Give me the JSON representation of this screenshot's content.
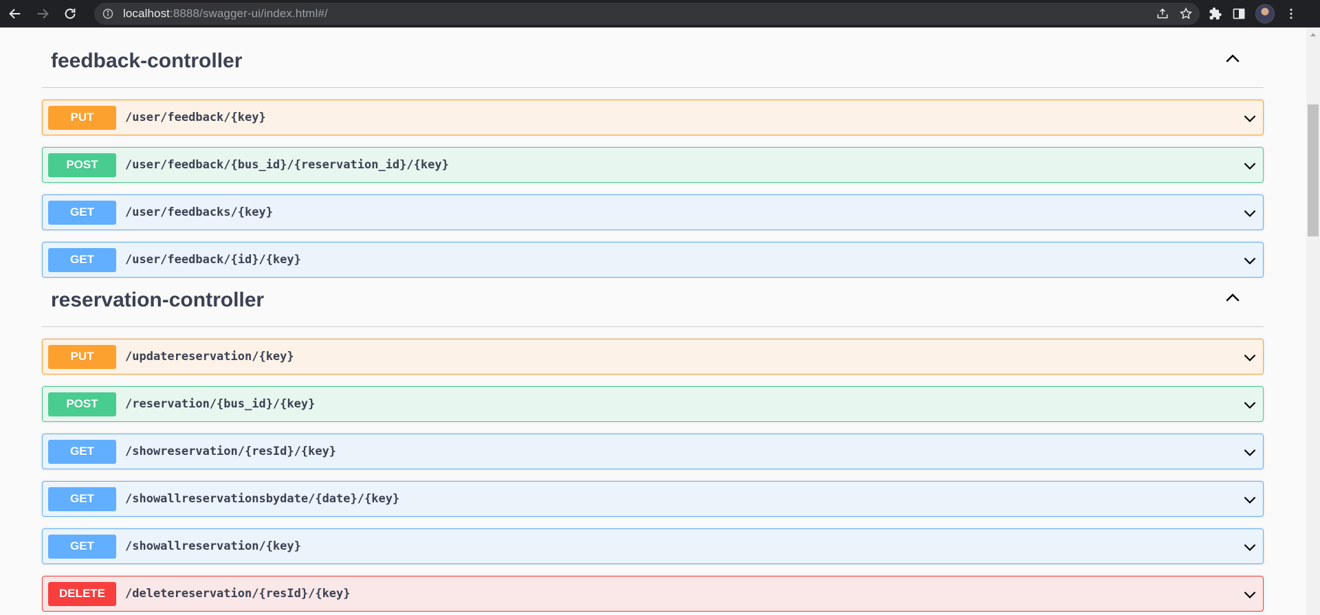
{
  "browser": {
    "url_host": "localhost",
    "url_rest": ":8888/swagger-ui/index.html#/"
  },
  "sections": [
    {
      "title": "feedback-controller",
      "operations": [
        {
          "method": "PUT",
          "path": "/user/feedback/{key}"
        },
        {
          "method": "POST",
          "path": "/user/feedback/{bus_id}/{reservation_id}/{key}"
        },
        {
          "method": "GET",
          "path": "/user/feedbacks/{key}"
        },
        {
          "method": "GET",
          "path": "/user/feedback/{id}/{key}"
        }
      ]
    },
    {
      "title": "reservation-controller",
      "operations": [
        {
          "method": "PUT",
          "path": "/updatereservation/{key}"
        },
        {
          "method": "POST",
          "path": "/reservation/{bus_id}/{key}"
        },
        {
          "method": "GET",
          "path": "/showreservation/{resId}/{key}"
        },
        {
          "method": "GET",
          "path": "/showallreservationsbydate/{date}/{key}"
        },
        {
          "method": "GET",
          "path": "/showallreservation/{key}"
        },
        {
          "method": "DELETE",
          "path": "/deletereservation/{resId}/{key}"
        }
      ]
    }
  ],
  "colors": {
    "put": "#fca130",
    "post": "#49cc90",
    "get": "#61affe",
    "delete": "#f93e3e"
  }
}
